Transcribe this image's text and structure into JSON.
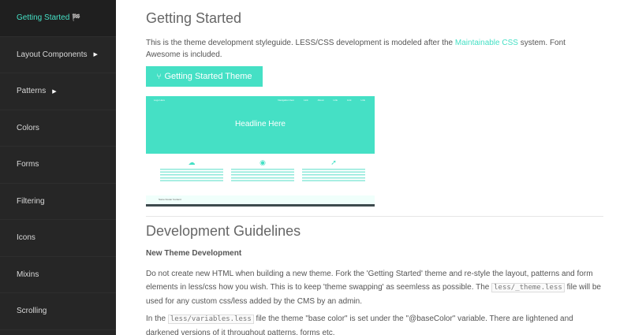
{
  "sidebar": {
    "items": [
      {
        "label": "Getting Started",
        "flag": "🏁"
      },
      {
        "label": "Layout Components",
        "caret": "▶"
      },
      {
        "label": "Patterns",
        "caret": "▶"
      },
      {
        "label": "Colors"
      },
      {
        "label": "Forms"
      },
      {
        "label": "Filtering"
      },
      {
        "label": "Icons"
      },
      {
        "label": "Mixins"
      },
      {
        "label": "Scrolling"
      }
    ]
  },
  "main": {
    "title": "Getting Started",
    "intro_before": "This is the theme development styleguide. LESS/CSS development is modeled after the ",
    "intro_link": "Maintainable CSS",
    "intro_after": " system. Font Awesome is included.",
    "button": {
      "icon": "⑂",
      "label": "Getting Started Theme"
    },
    "preview": {
      "brand": "Logo Here",
      "nav": [
        "Navigation Item",
        "Link",
        "About",
        "Link",
        "Link",
        "Link"
      ],
      "headline": "Headline Here",
      "icons": [
        "cloud-icon",
        "dashboard-icon",
        "rocket-icon"
      ],
      "icon_glyphs": [
        "☁",
        "◉",
        "➚"
      ],
      "footer": "Some Footer Content"
    },
    "h2": "Development Guidelines",
    "h3": "New Theme Development",
    "p1_a": "Do not create new HTML when building a new theme. Fork the 'Getting Started' theme and re-style the layout, patterns and form elements in less/css how you wish. This is to keep 'theme swapping' as seemless as possible. The ",
    "p1_code": "less/_theme.less",
    "p1_b": " file will be used for any custom css/less added by the CMS by an admin.",
    "p2_a": "In the ",
    "p2_code": "less/variables.less",
    "p2_b": " file the theme \"base color\" is set under the \"@baseColor\" variable. There are lightened and darkened versions of it throughout patterns, forms etc."
  },
  "colors": {
    "accent": "#45e0c5",
    "sidebar": "#262626"
  }
}
